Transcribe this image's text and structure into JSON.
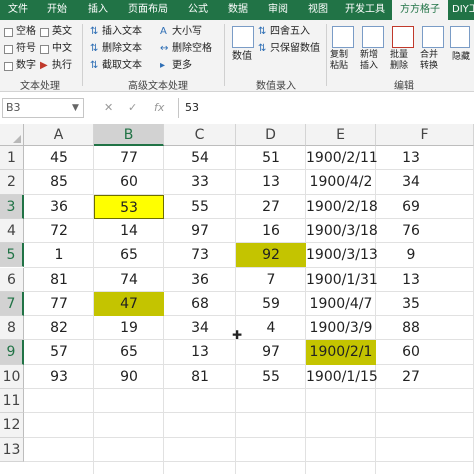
{
  "ribbon_tabs": [
    "文件",
    "开始",
    "插入",
    "页面布局",
    "公式",
    "数据",
    "审阅",
    "视图",
    "开发工具",
    "方方格子",
    "DIY工具"
  ],
  "ribbon": {
    "text_group": {
      "checks": [
        "空格",
        "英文",
        "符号",
        "中文",
        "数字"
      ],
      "execute": "执行",
      "label": "文本处理"
    },
    "adv_group": {
      "items": [
        "插入文本",
        "大小写",
        "删除文本",
        "删除空格",
        "截取文本",
        "更多"
      ],
      "label": "高级文本处理"
    },
    "num_group": {
      "value_label": "数值",
      "items": [
        "四舍五入",
        "只保留数值"
      ],
      "label": "数值录入"
    },
    "edit_group": {
      "buttons": [
        "复制粘贴",
        "新增插入",
        "批量删除",
        "合并转换",
        "隐藏"
      ],
      "label": "编辑"
    }
  },
  "formula_bar": {
    "name_box": "B3",
    "cancel_icon": "✕",
    "enter_icon": "✓",
    "fx_icon": "fx",
    "content": "53"
  },
  "columns": [
    "A",
    "B",
    "C",
    "D",
    "E",
    "F"
  ],
  "selected_column": "B",
  "rows": [
    "1",
    "2",
    "3",
    "4",
    "5",
    "6",
    "7",
    "8",
    "9",
    "10",
    "11",
    "12",
    "13"
  ],
  "selected_rows": [
    "3",
    "5",
    "7",
    "9"
  ],
  "table": [
    [
      "45",
      "77",
      "54",
      "51",
      "1900/2/11",
      "13"
    ],
    [
      "85",
      "60",
      "33",
      "13",
      "1900/4/2",
      "34"
    ],
    [
      "36",
      "53",
      "55",
      "27",
      "1900/2/18",
      "69"
    ],
    [
      "72",
      "14",
      "97",
      "16",
      "1900/3/18",
      "76"
    ],
    [
      "1",
      "65",
      "73",
      "92",
      "1900/3/13",
      "9"
    ],
    [
      "81",
      "74",
      "36",
      "7",
      "1900/1/31",
      "13"
    ],
    [
      "77",
      "47",
      "68",
      "59",
      "1900/4/7",
      "35"
    ],
    [
      "82",
      "19",
      "34",
      "4",
      "1900/3/9",
      "88"
    ],
    [
      "57",
      "65",
      "13",
      "97",
      "1900/2/1",
      "60"
    ],
    [
      "93",
      "90",
      "81",
      "55",
      "1900/1/15",
      "27"
    ]
  ],
  "highlighted_cells": [
    {
      "row": 3,
      "col": "B",
      "color": "#ffff00"
    },
    {
      "row": 5,
      "col": "D",
      "color": "#c4c400"
    },
    {
      "row": 7,
      "col": "B",
      "color": "#c4c400"
    },
    {
      "row": 9,
      "col": "E",
      "color": "#c4c400"
    }
  ],
  "colors": {
    "tab_bar": "#217346",
    "yellow_fill": "#ffff00",
    "olive_fill": "#c4c400"
  }
}
